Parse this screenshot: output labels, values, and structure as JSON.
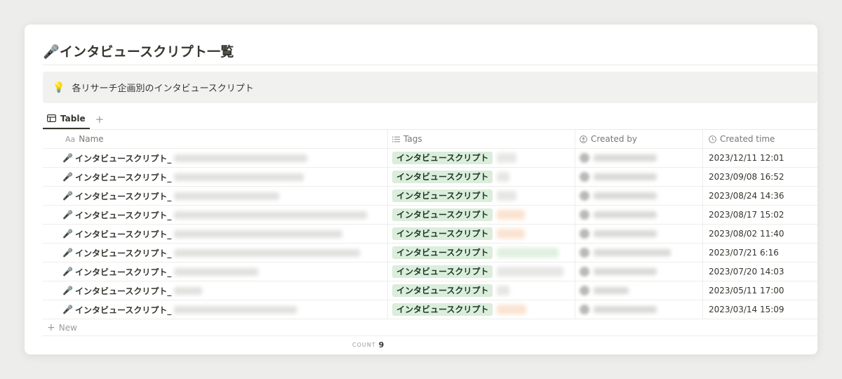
{
  "page": {
    "icon": "microphone-icon",
    "title": "🎤インタビュースクリプト一覧"
  },
  "callout": {
    "icon": "💡",
    "text": "各リサーチ企画別のインタビュースクリプト"
  },
  "views": {
    "tabs": [
      {
        "label": "Table",
        "icon": "table-icon"
      }
    ],
    "add_view": "+"
  },
  "table": {
    "columns": [
      {
        "key": "name",
        "label": "Name",
        "icon": "Aa"
      },
      {
        "key": "tags",
        "label": "Tags",
        "icon": "list-icon"
      },
      {
        "key": "created_by",
        "label": "Created by",
        "icon": "person-icon"
      },
      {
        "key": "created_time",
        "label": "Created time",
        "icon": "clock-icon"
      }
    ],
    "rows": [
      {
        "name": "インタビュースクリプト_",
        "tag": "インタビュースクリプト",
        "created_time": "2023/12/11 12:01"
      },
      {
        "name": "インタビュースクリプト_",
        "tag": "インタビュースクリプト",
        "created_time": "2023/09/08 16:52"
      },
      {
        "name": "インタビュースクリプト_",
        "tag": "インタビュースクリプト",
        "created_time": "2023/08/24 14:36"
      },
      {
        "name": "インタビュースクリプト_",
        "tag": "インタビュースクリプト",
        "created_time": "2023/08/17 15:02"
      },
      {
        "name": "インタビュースクリプト_",
        "tag": "インタビュースクリプト",
        "created_time": "2023/08/02 11:40"
      },
      {
        "name": "インタビュースクリプト_",
        "tag": "インタビュースクリプト",
        "created_time": "2023/07/21 6:16"
      },
      {
        "name": "インタビュースクリプト_",
        "tag": "インタビュースクリプト",
        "created_time": "2023/07/20 14:03"
      },
      {
        "name": "インタビュースクリプト_",
        "tag": "インタビュースクリプト",
        "created_time": "2023/05/11 17:00"
      },
      {
        "name": "インタビュースクリプト_",
        "tag": "インタビュースクリプト",
        "created_time": "2023/03/14 15:09"
      }
    ],
    "new_label": "New"
  },
  "footer": {
    "count_label": "COUNT",
    "count_value": "9"
  },
  "colors": {
    "tag_background": "#dbeddb",
    "tag_text": "#1c3829",
    "callout_background": "#f1f1ef",
    "page_background": "#ededec"
  }
}
